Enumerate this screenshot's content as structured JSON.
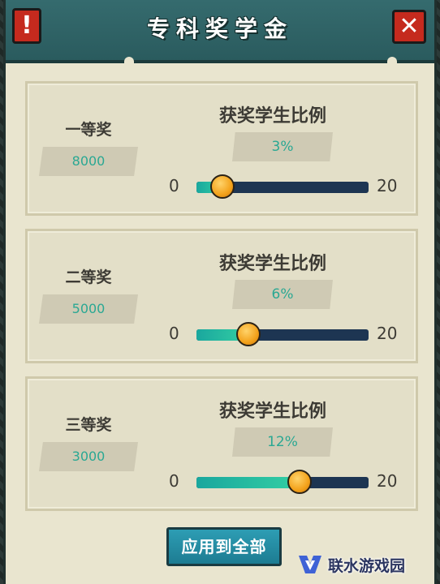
{
  "header": {
    "title": "专科奖学金",
    "alert_icon": "!",
    "close_icon": "✕"
  },
  "tiers": [
    {
      "name": "一等奖",
      "amount": "8000",
      "ratio_title": "获奖学生比例",
      "percent_text": "3%",
      "slider": {
        "min": "0",
        "max": "20",
        "value": 3
      }
    },
    {
      "name": "二等奖",
      "amount": "5000",
      "ratio_title": "获奖学生比例",
      "percent_text": "6%",
      "slider": {
        "min": "0",
        "max": "20",
        "value": 6
      }
    },
    {
      "name": "三等奖",
      "amount": "3000",
      "ratio_title": "获奖学生比例",
      "percent_text": "12%",
      "slider": {
        "min": "0",
        "max": "20",
        "value": 12
      }
    }
  ],
  "apply_all_label": "应用到全部",
  "watermark": "联水游戏园",
  "colors": {
    "header_bg": "#2f6265",
    "panel_bg": "#e3dfc8",
    "value_text": "#2aa893",
    "slider_fill": "#1aa79e",
    "slider_track": "#1d3552",
    "knob": "#f3a21b",
    "close_button": "#c52a1e",
    "apply_button": "#2690a8"
  }
}
